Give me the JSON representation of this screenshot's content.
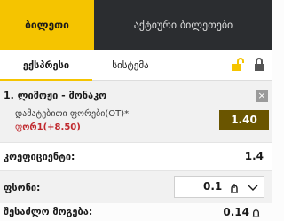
{
  "top_tabs": {
    "active": "ბილეთი",
    "inactive": "აქტიური ბილეთები"
  },
  "sub_tabs": {
    "express": "ექსპრესი",
    "system": "სისტემა"
  },
  "icons": {
    "unlock": "unlock-icon",
    "lock": "lock-icon",
    "close": "close-icon",
    "coin": "currency-icon",
    "chevron": "chevron-down-icon"
  },
  "bet": {
    "index_title": "1. ლიმოჟი - მონაკო",
    "market": "დამატებითი ფორები(OT)*",
    "selection_prefix": "ფ",
    "selection_main": "ორ1",
    "selection_handicap": "(+8.50)",
    "odds": "1.40",
    "close_label": "×"
  },
  "summary": {
    "coef_label": "კოეფიციენტი:",
    "coef_value": "1.4",
    "stake_label": "ფსონი:",
    "stake_value": "0.1",
    "win_label": "შესაძლო მოგება:",
    "win_value": "0.14"
  },
  "colors": {
    "accent": "#f5c400",
    "dark": "#2b2d30",
    "odds_bg": "#6a5500",
    "red": "#c0282d"
  }
}
